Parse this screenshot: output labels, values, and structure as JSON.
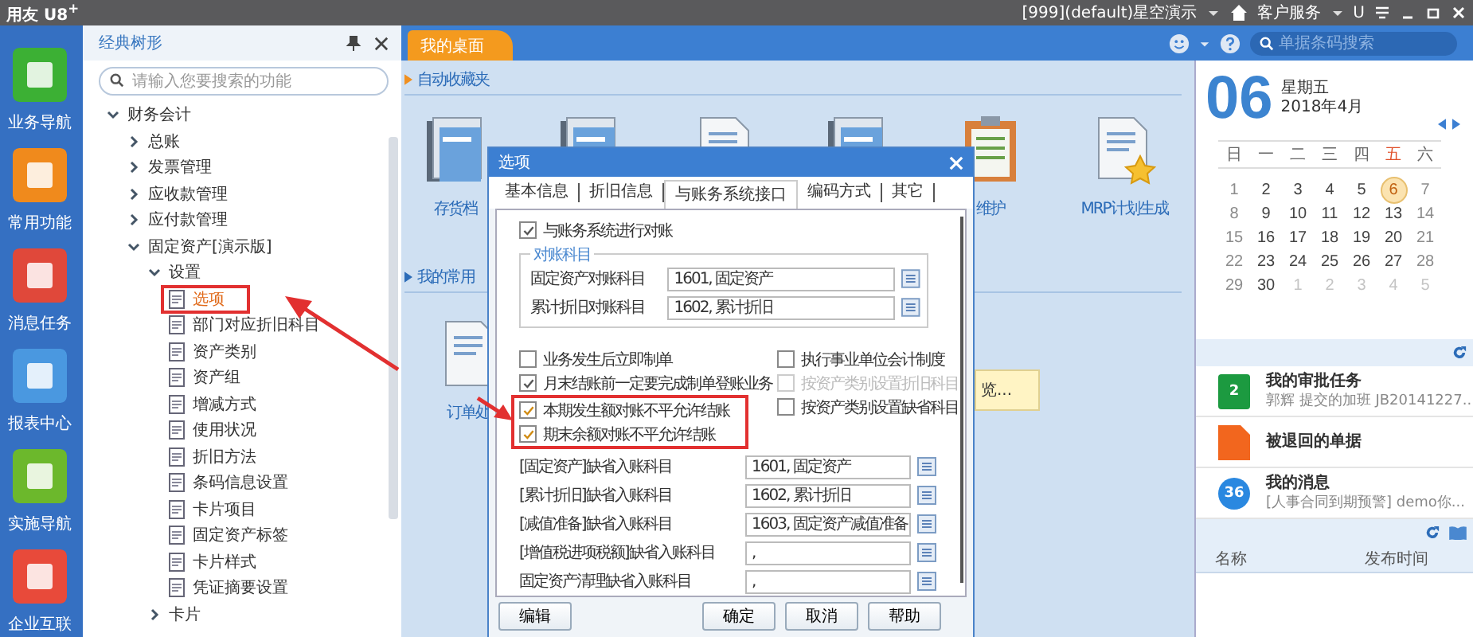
{
  "app_bar": {
    "title": "用友 U8$^{+}$",
    "account": "[999](default)星空演示",
    "service": "客户服务",
    "u_label": "U"
  },
  "nav_rail": [
    {
      "label": "业务导航",
      "color": "#3cb034"
    },
    {
      "label": "常用功能",
      "color": "#f08a1c"
    },
    {
      "label": "消息任务",
      "color": "#e0483a"
    },
    {
      "label": "报表中心",
      "color": "#4a98e0"
    },
    {
      "label": "实施导航",
      "color": "#6cb82c"
    },
    {
      "label": "企业互联",
      "color": "#e84a3a"
    }
  ],
  "tree_panel": {
    "title": "经典树形",
    "search": {
      "placeholder": "请输入您要搜索的功能"
    },
    "nodes": [
      {
        "kind": "group",
        "label": "财务会计",
        "expanded": true,
        "selected": false,
        "children": [
          {
            "kind": "group",
            "label": "总账",
            "expanded": false,
            "selected": false
          },
          {
            "kind": "group",
            "label": "发票管理",
            "expanded": false,
            "selected": false
          },
          {
            "kind": "group",
            "label": "应收款管理",
            "expanded": false,
            "selected": false
          },
          {
            "kind": "group",
            "label": "应付款管理",
            "expanded": false,
            "selected": false
          },
          {
            "kind": "group",
            "label": "固定资产[演示版]",
            "expanded": true,
            "selected": false,
            "children": [
              {
                "kind": "group",
                "label": "设置",
                "expanded": true,
                "selected": false,
                "children": [
                  {
                    "kind": "page",
                    "label": "选项",
                    "selected": true,
                    "highlighted": true
                  },
                  {
                    "kind": "page",
                    "label": "部门对应折旧科目",
                    "selected": false,
                    "highlighted": false
                  },
                  {
                    "kind": "page",
                    "label": "资产类别",
                    "selected": false,
                    "highlighted": false
                  },
                  {
                    "kind": "page",
                    "label": "资产组",
                    "selected": false,
                    "highlighted": false
                  },
                  {
                    "kind": "page",
                    "label": "增减方式",
                    "selected": false,
                    "highlighted": false
                  },
                  {
                    "kind": "page",
                    "label": "使用状况",
                    "selected": false,
                    "highlighted": false
                  },
                  {
                    "kind": "page",
                    "label": "折旧方法",
                    "selected": false,
                    "highlighted": false
                  },
                  {
                    "kind": "page",
                    "label": "条码信息设置",
                    "selected": false,
                    "highlighted": false
                  },
                  {
                    "kind": "page",
                    "label": "卡片项目",
                    "selected": false,
                    "highlighted": false
                  },
                  {
                    "kind": "page",
                    "label": "固定资产标签",
                    "selected": false,
                    "highlighted": false
                  },
                  {
                    "kind": "page",
                    "label": "卡片样式",
                    "selected": false,
                    "highlighted": false
                  },
                  {
                    "kind": "page",
                    "label": "凭证摘要设置",
                    "selected": false,
                    "highlighted": false
                  }
                ]
              },
              {
                "kind": "group",
                "label": "卡片",
                "expanded": false,
                "selected": false
              }
            ]
          }
        ]
      }
    ]
  },
  "tabs": [
    {
      "label": "我的桌面",
      "selected": true
    }
  ],
  "search": {
    "placeholder": "单据条码搜索"
  },
  "favorites": {
    "title": "自动收藏夹",
    "items": [
      {
        "kind": "binder",
        "label": "存货档"
      },
      {
        "kind": "binder"
      },
      {
        "kind": "document"
      },
      {
        "kind": "binder"
      },
      {
        "kind": "clipboard",
        "label": "维护"
      },
      {
        "kind": "document_star",
        "label": "MRP计划生成"
      }
    ]
  },
  "frequent": {
    "title": "我的常用",
    "items": [
      {
        "kind": "document",
        "label": "订单处"
      }
    ],
    "note": "览..."
  },
  "dialog": {
    "title": "选项",
    "tabs": [
      {
        "label": "基本信息",
        "selected": false
      },
      {
        "label": "折旧信息",
        "selected": false
      },
      {
        "label": "与账务系统接口",
        "selected": true
      },
      {
        "label": "编码方式",
        "selected": false
      },
      {
        "label": "其它",
        "selected": false
      }
    ],
    "reconcile": {
      "label": "与账务系统进行对账",
      "checked": true
    },
    "account_group": {
      "legend": "对账科目",
      "rows": [
        {
          "label": "固定资产对账科目",
          "value": "1601, 固定资产"
        },
        {
          "label": "累计折旧对账科目",
          "value": "1602, 累计折旧"
        }
      ]
    },
    "options_left": [
      {
        "label": "业务发生后立即制单",
        "checked": false,
        "highlighted": false
      },
      {
        "label": "月末结账前一定要完成制单登账业务",
        "checked": true,
        "highlighted": false
      },
      {
        "label": "本期发生额对账不平允许结账",
        "checked": true,
        "highlighted": true
      },
      {
        "label": "期末余额对账不平允许结账",
        "checked": true,
        "highlighted": true
      }
    ],
    "options_right": [
      {
        "label": "执行事业单位会计制度",
        "checked": false,
        "disabled": false
      },
      {
        "label": "按资产类别设置折旧科目",
        "checked": false,
        "disabled": true
      },
      {
        "label": "按资产类别设置缺省科目",
        "checked": false,
        "disabled": false
      }
    ],
    "default_accounts": [
      {
        "label": "[固定资产]缺省入账科目",
        "value": "1601, 固定资产"
      },
      {
        "label": "[累计折旧]缺省入账科目",
        "value": "1602, 累计折旧"
      },
      {
        "label": "[减值准备]缺省入账科目",
        "value": "1603, 固定资产减值准备"
      },
      {
        "label": "[增值税进项税额]缺省入账科目",
        "value": ","
      },
      {
        "label": "固定资产清理缺省入账科目",
        "value": ","
      }
    ],
    "buttons": [
      {
        "label": "编辑"
      },
      {
        "label": "确定"
      },
      {
        "label": "取消"
      },
      {
        "label": "帮助"
      }
    ]
  },
  "calendar": {
    "day": "06",
    "weekday": "星期五",
    "month": "2018年4月",
    "weekdays": [
      {
        "label": "日",
        "selected": false
      },
      {
        "label": "一",
        "selected": false
      },
      {
        "label": "二",
        "selected": false
      },
      {
        "label": "三",
        "selected": false
      },
      {
        "label": "四",
        "selected": false
      },
      {
        "label": "五",
        "selected": true
      },
      {
        "label": "六",
        "selected": false
      }
    ],
    "weeks": [
      [
        {
          "day": "1",
          "other_month": false,
          "selected": false
        },
        {
          "day": "2",
          "other_month": false,
          "selected": false
        },
        {
          "day": "3",
          "other_month": false,
          "selected": false
        },
        {
          "day": "4",
          "other_month": false,
          "selected": false
        },
        {
          "day": "5",
          "other_month": false,
          "selected": false
        },
        {
          "day": "6",
          "other_month": false,
          "selected": true
        },
        {
          "day": "7",
          "other_month": false,
          "selected": false
        }
      ],
      [
        {
          "day": "8",
          "other_month": false,
          "selected": false
        },
        {
          "day": "9",
          "other_month": false,
          "selected": false
        },
        {
          "day": "10",
          "other_month": false,
          "selected": false
        },
        {
          "day": "11",
          "other_month": false,
          "selected": false
        },
        {
          "day": "12",
          "other_month": false,
          "selected": false
        },
        {
          "day": "13",
          "other_month": false,
          "selected": false
        },
        {
          "day": "14",
          "other_month": false,
          "selected": false
        }
      ],
      [
        {
          "day": "15",
          "other_month": false,
          "selected": false
        },
        {
          "day": "16",
          "other_month": false,
          "selected": false
        },
        {
          "day": "17",
          "other_month": false,
          "selected": false
        },
        {
          "day": "18",
          "other_month": false,
          "selected": false
        },
        {
          "day": "19",
          "other_month": false,
          "selected": false
        },
        {
          "day": "20",
          "other_month": false,
          "selected": false
        },
        {
          "day": "21",
          "other_month": false,
          "selected": false
        }
      ],
      [
        {
          "day": "22",
          "other_month": false,
          "selected": false
        },
        {
          "day": "23",
          "other_month": false,
          "selected": false
        },
        {
          "day": "24",
          "other_month": false,
          "selected": false
        },
        {
          "day": "25",
          "other_month": false,
          "selected": false
        },
        {
          "day": "26",
          "other_month": false,
          "selected": false
        },
        {
          "day": "27",
          "other_month": false,
          "selected": false
        },
        {
          "day": "28",
          "other_month": false,
          "selected": false
        }
      ],
      [
        {
          "day": "29",
          "other_month": false,
          "selected": false
        },
        {
          "day": "30",
          "other_month": false,
          "selected": false
        },
        {
          "day": "1",
          "other_month": true,
          "selected": false
        },
        {
          "day": "2",
          "other_month": true,
          "selected": false
        },
        {
          "day": "3",
          "other_month": true,
          "selected": false
        },
        {
          "day": "4",
          "other_month": true,
          "selected": false
        },
        {
          "day": "5",
          "other_month": true,
          "selected": false
        }
      ]
    ]
  },
  "tasks": [
    {
      "kind": "approval",
      "badge": "2",
      "title": "我的审批任务",
      "detail": "郭辉 提交的加班 JB20141227..."
    },
    {
      "kind": "returned",
      "title": "被退回的单据"
    },
    {
      "kind": "message",
      "badge": "36",
      "title": "我的消息",
      "detail": "[人事合同到期预警] demo你..."
    }
  ],
  "notices": {
    "columns": [
      "名称",
      "发布时间"
    ]
  }
}
